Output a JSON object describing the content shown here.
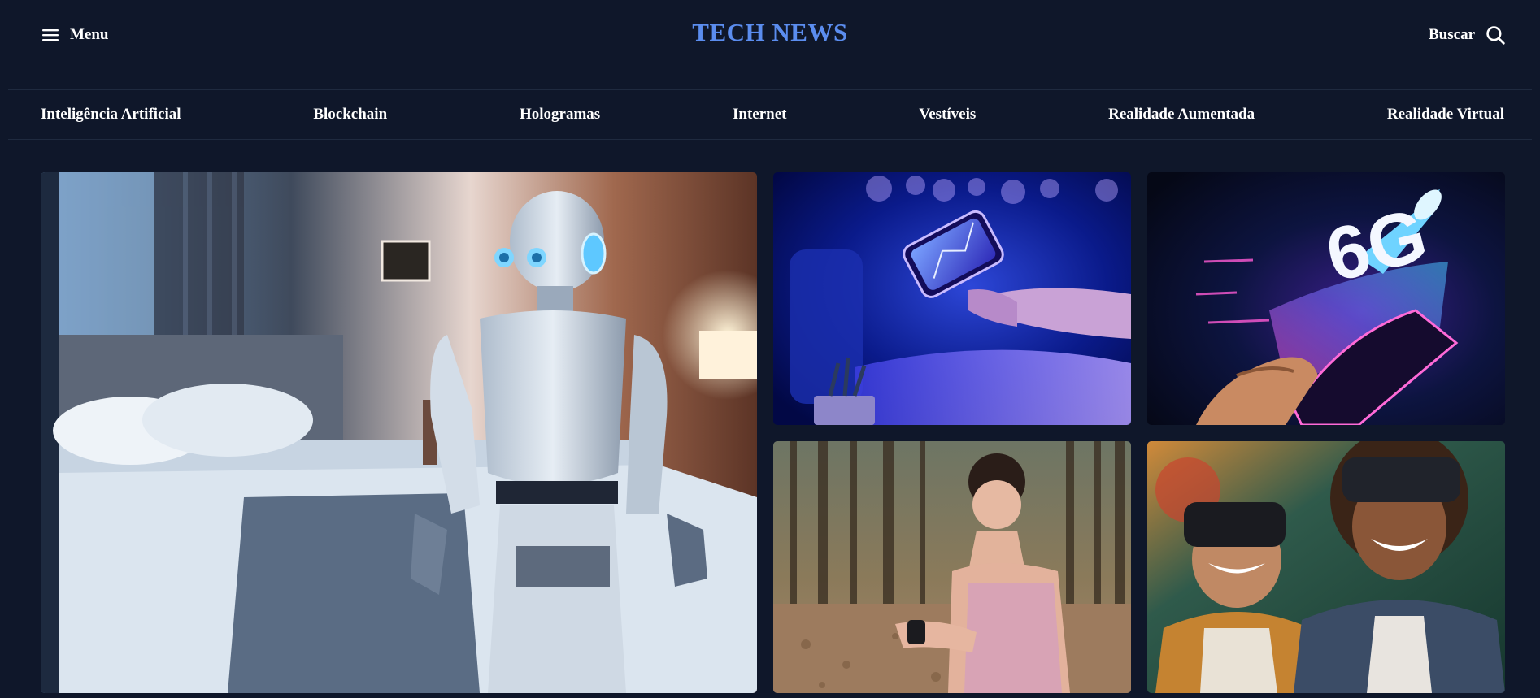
{
  "header": {
    "menu_label": "Menu",
    "brand": "TECH NEWS",
    "search_label": "Buscar",
    "menu_icon": "hamburger-icon",
    "search_icon": "search-icon",
    "brand_color": "#5b8def",
    "background": "#0f172a"
  },
  "nav": {
    "items": [
      "Inteligência Artificial",
      "Blockchain",
      "Hologramas",
      "Internet",
      "Vestíveis",
      "Realidade Aumentada",
      "Realidade Virtual"
    ]
  },
  "featured": [
    {
      "image": "robot-in-bedroom-image"
    },
    {
      "image": "hand-holding-smartphone-image"
    },
    {
      "image": "6g-smartphone-rocket-image"
    },
    {
      "image": "woman-checking-smartwatch-image"
    },
    {
      "image": "kids-wearing-vr-headsets-image"
    }
  ],
  "tile_text": {
    "six_g": "6G"
  }
}
